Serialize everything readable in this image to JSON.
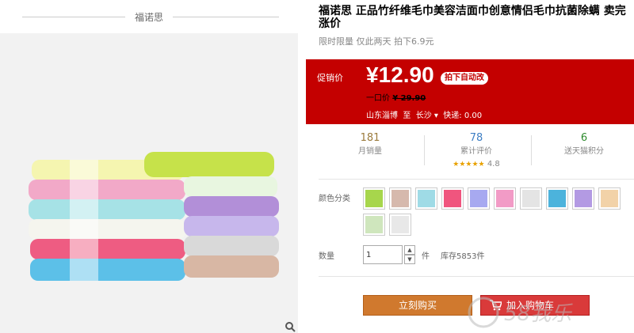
{
  "image_panel": {
    "brand_name": "福诺思",
    "zoom_icon": "search-icon"
  },
  "product": {
    "title": "福诺思 正品竹纤维毛巾美容洁面巾创意情侣毛巾抗菌除螨 卖完涨价",
    "subtitle": "限时限量 仅此两天 拍下6.9元"
  },
  "promo": {
    "label": "促销价",
    "price": "¥12.90",
    "badge": "拍下自动改",
    "orig_price_label": "一口价",
    "orig_price": "¥ 29.90",
    "ship_from": "山东淄博",
    "ship_to_word": "至",
    "ship_to": "长沙",
    "shipping_label": "快递:",
    "shipping_fee": "0.00",
    "background_color": "#c40000"
  },
  "stats": {
    "monthly_sales": "181",
    "monthly_sales_label": "月销量",
    "reviews": "78",
    "reviews_label": "累计评价",
    "stars": "★★★★★",
    "rating": "4.8",
    "points": "6",
    "points_label": "送天猫积分"
  },
  "options": {
    "color_label": "颜色分类",
    "swatch_colors": [
      "#a7d64c",
      "#d6b9ad",
      "#9fdbe6",
      "#f0557e",
      "#a7a9f0",
      "#f29bc6",
      "#e4e4e4",
      "#4cb3dc",
      "#b39ae3",
      "#f2d2a8",
      "#cfe6bd",
      "#e8e8e8"
    ],
    "qty_label": "数量",
    "qty_value": "1",
    "qty_unit": "件",
    "stock": "库存5853件"
  },
  "actions": {
    "buy_now": "立刻购买",
    "add_to_cart": "加入购物车",
    "buy_color": "#d0792e",
    "cart_color": "#d93a3a"
  },
  "watermark": {
    "text": "58我乐"
  }
}
